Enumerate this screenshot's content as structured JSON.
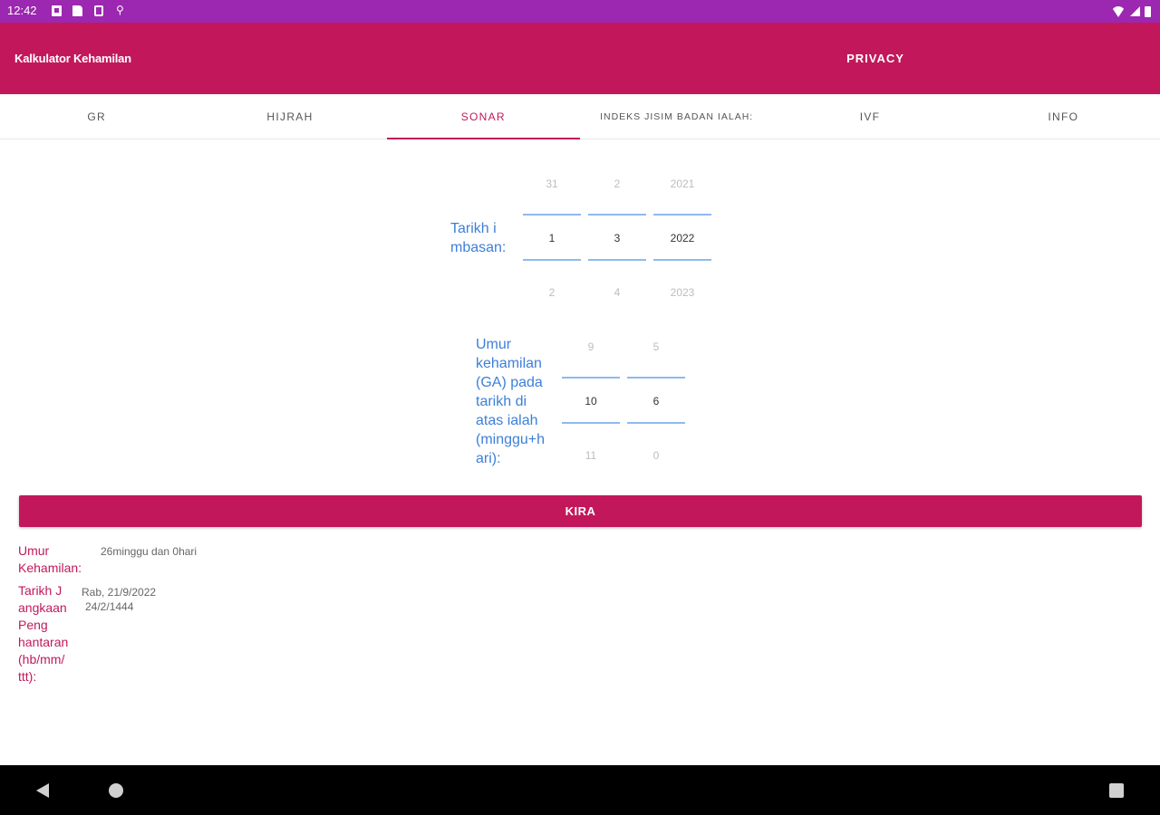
{
  "status_bar": {
    "time": "12:42",
    "left_icons": [
      "notification-icon",
      "sd-card-icon",
      "security-icon",
      "network-icon"
    ],
    "right_icons": [
      "wifi-icon",
      "signal-icon",
      "battery-icon"
    ]
  },
  "app_bar": {
    "title": "Kalkulator Kehamilan",
    "privacy_label": "PRIVACY",
    "color": "#c2185b"
  },
  "tabs": [
    {
      "label": "GR",
      "active": false
    },
    {
      "label": "HIJRAH",
      "active": false
    },
    {
      "label": "SONAR",
      "active": true
    },
    {
      "label": "INDEKS JISIM BADAN IALAH:",
      "active": false
    },
    {
      "label": "IVF",
      "active": false
    },
    {
      "label": "INFO",
      "active": false
    }
  ],
  "scan_date": {
    "label": "Tarikh i\nmbasan:",
    "day": {
      "prev": "31",
      "current": "1",
      "next": "2"
    },
    "month": {
      "prev": "2",
      "current": "3",
      "next": "4"
    },
    "year": {
      "prev": "2021",
      "current": "2022",
      "next": "2023"
    }
  },
  "gestational_age": {
    "label": "Umur\nkehamilan\n(GA) pada\ntarikh di\natas ialah\n(minggu+h\nari):",
    "weeks": {
      "prev": "9",
      "current": "10",
      "next": "11"
    },
    "days": {
      "prev": "5",
      "current": "6",
      "next": "0"
    }
  },
  "calculate_button": {
    "label": "KIRA"
  },
  "results": {
    "age_label": "Umur\nKehamilan:",
    "age_value": "26minggu dan 0hari",
    "due_label": "Tarikh J\nangkaan\nPeng\nhantaran\n(hb/mm/\nttt):",
    "due_value_gregorian": "Rab, 21/9/2022",
    "due_value_hijri": "24/2/1444"
  },
  "colors": {
    "status_bar": "#9c27b0",
    "primary": "#c2185b",
    "label_blue": "#3d7fd8",
    "picker_line": "#90b9f0"
  },
  "nav_bar": {
    "icons": [
      "back-icon",
      "home-icon",
      "recents-icon"
    ]
  }
}
